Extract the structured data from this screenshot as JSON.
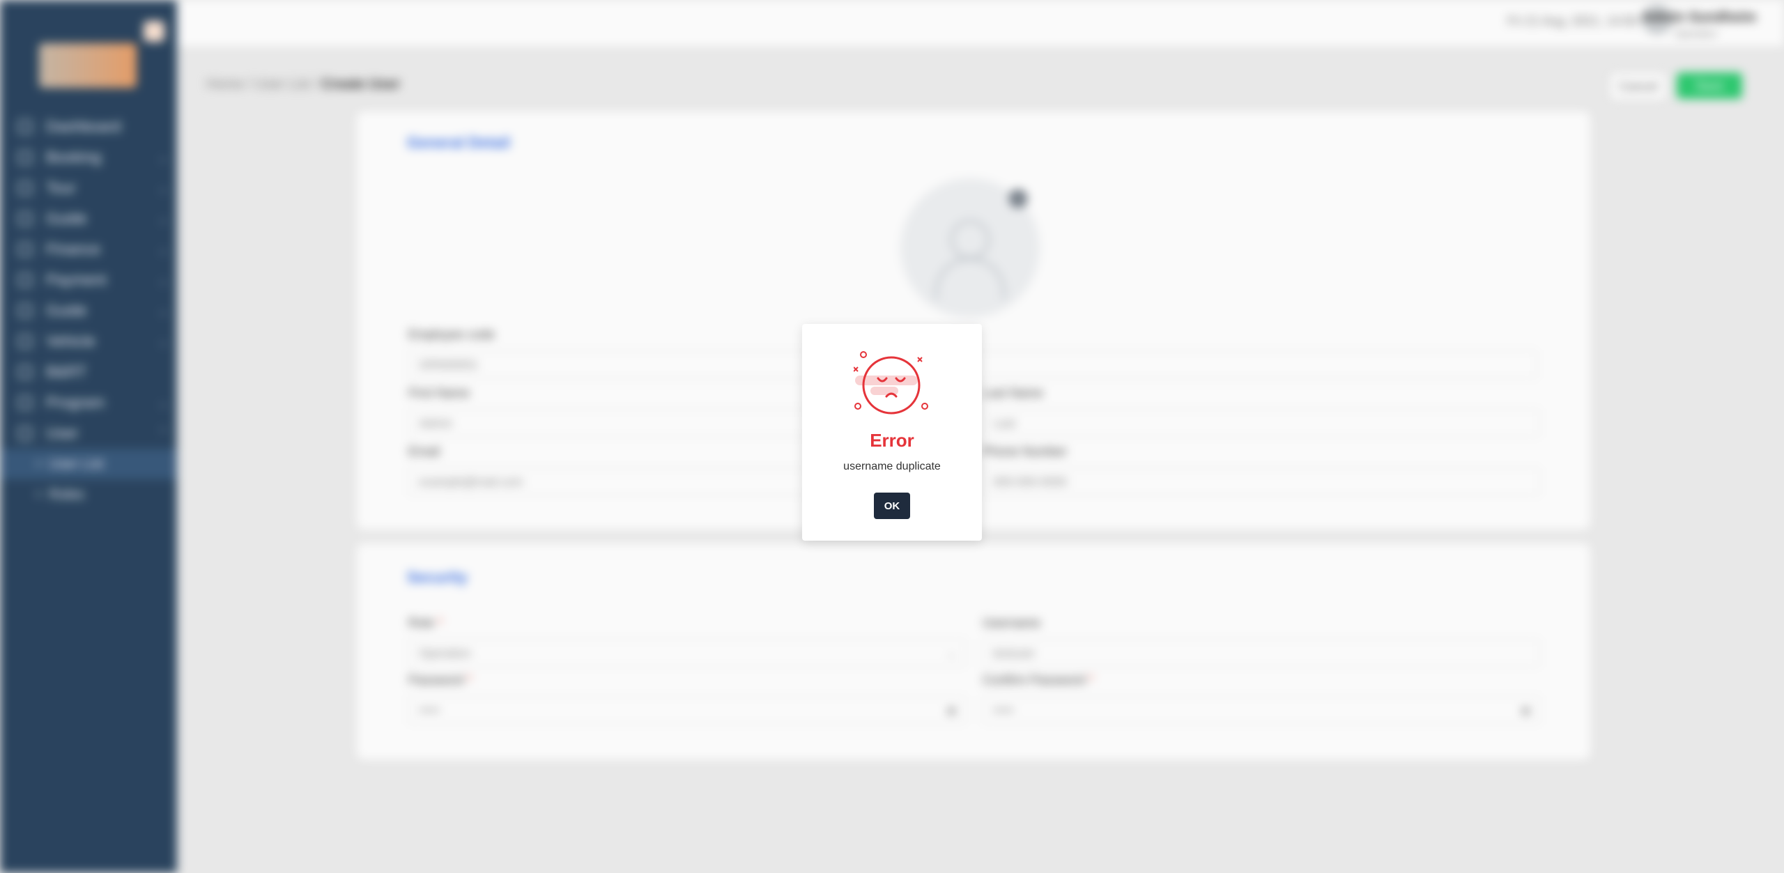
{
  "sidebar": {
    "items": [
      {
        "label": "Dashboard"
      },
      {
        "label": "Booking"
      },
      {
        "label": "Tour"
      },
      {
        "label": "Guide"
      },
      {
        "label": "Finance"
      },
      {
        "label": "Payment"
      },
      {
        "label": "Guide"
      },
      {
        "label": "Vehicle"
      },
      {
        "label": "B&RT"
      },
      {
        "label": "Program"
      },
      {
        "label": "User"
      }
    ],
    "subitems": [
      {
        "label": "User List"
      },
      {
        "label": "Roles"
      }
    ]
  },
  "topbar": {
    "date": "Fri 21 Aug, 2021, 14:00",
    "user_name": "Admin Sundheim",
    "user_role": "Operation"
  },
  "breadcrumb": {
    "home": "Home",
    "sep": "/",
    "parent": "User List",
    "current": "Create User"
  },
  "actions": {
    "cancel": "Cancel",
    "save": "Save"
  },
  "general": {
    "title": "General Detail",
    "employee_code_label": "Employee code",
    "employee_code_value": "GRN00001",
    "first_name_label": "First Name",
    "first_name_value": "Admin",
    "last_name_label": "Last Name",
    "last_name_value": "Last",
    "email_label": "Email",
    "email_placeholder": "example@mail.com",
    "phone_label": "Phone Number",
    "phone_placeholder": "000-000-0000"
  },
  "security": {
    "title": "Security",
    "role_label": "Role",
    "role_value": "Operation",
    "username_label": "Username",
    "username_value": "testuser",
    "password_label": "Password",
    "password_value": "•••••",
    "confirm_label": "Confirm Password",
    "confirm_value": "•••••",
    "required_mark": "*"
  },
  "dialog": {
    "icon": "sad-face-icon",
    "title": "Error",
    "message": "username duplicate",
    "ok": "OK",
    "accent": "#e5343a"
  }
}
